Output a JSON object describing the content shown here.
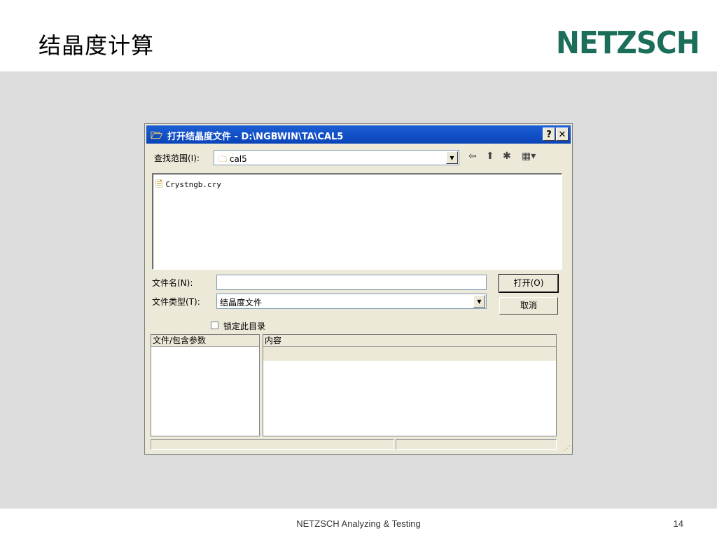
{
  "slide": {
    "title": "结晶度计算",
    "logo": "NETZSCH",
    "footer": "NETZSCH Analyzing & Testing",
    "page_number": "14"
  },
  "dialog": {
    "title": "打开结晶度文件 - D:\\NGBWIN\\TA\\CAL5",
    "help_button": "?",
    "close_button": "✕",
    "lookin_label": "查找范围(I):",
    "lookin_value": "cal5",
    "files": [
      {
        "name": "Crystngb.cry",
        "icon": "document-icon"
      }
    ],
    "filename_label": "文件名(N):",
    "filename_value": "",
    "filetype_label": "文件类型(T):",
    "filetype_value": "结晶度文件",
    "open_button": "打开(O)",
    "cancel_button": "取消",
    "lock_dir_label": "锁定此目录",
    "lock_dir_checked": false,
    "params_header": "文件/包含参数",
    "content_header": "内容"
  },
  "colors": {
    "logo": "#1a6e5a",
    "titlebar": "#0a43b8",
    "band": "#dcdcdc",
    "dialog_bg": "#ece9d8"
  }
}
